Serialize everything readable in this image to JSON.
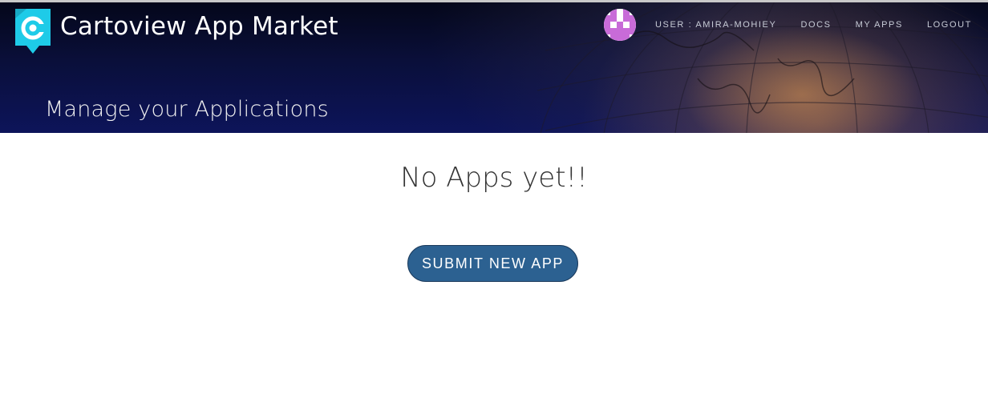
{
  "header": {
    "brand_name": "Cartoview App Market",
    "logo_icon": "cartoview-logo-icon",
    "page_heading": "Manage your Applications"
  },
  "nav": {
    "avatar_icon": "identicon-avatar",
    "user_label": "USER : AMIRA-MOHIEY",
    "docs_label": "DOCS",
    "my_apps_label": "MY APPS",
    "logout_label": "LOGOUT"
  },
  "main": {
    "empty_message": "No Apps yet!!",
    "submit_label": "SUBMIT NEW APP"
  },
  "colors": {
    "header_bg": "#0b1145",
    "logo_cyan": "#1ecbe8",
    "button_bg": "#2c6191",
    "avatar_accent": "#c86bd8"
  }
}
